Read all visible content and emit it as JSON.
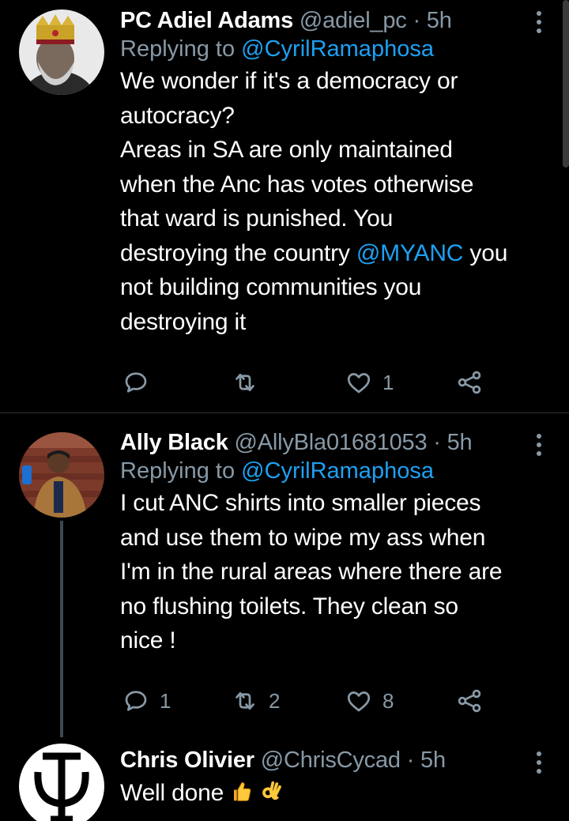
{
  "tweets": [
    {
      "name": "PC Adiel Adams",
      "handle": "@adiel_pc",
      "dot": "·",
      "time": "5h",
      "replying_prefix": "Replying to ",
      "replying_to": "@CyrilRamaphosa",
      "lines": [
        "We wonder if it's a democracy or",
        "autocracy?",
        "Areas in SA are only maintained",
        "when the Anc has votes otherwise",
        "that ward is punished. You"
      ],
      "line6_pre": "destroying the country ",
      "line6_mention": "@MYANC",
      "line6_post": " you",
      "lines_after": [
        "not building communities you",
        "destroying it"
      ],
      "reply_count": "",
      "retweet_count": "",
      "like_count": "1"
    },
    {
      "name": "Ally Black",
      "handle": "@AllyBla01681053",
      "dot": "·",
      "time": "5h",
      "replying_prefix": "Replying to ",
      "replying_to": "@CyrilRamaphosa",
      "lines": [
        "I cut ANC shirts into smaller pieces",
        "and use them to wipe my ass when",
        "I'm in the rural areas where there are",
        "no flushing toilets. They clean so",
        "nice !"
      ],
      "reply_count": "1",
      "retweet_count": "2",
      "like_count": "8"
    },
    {
      "name": "Chris Olivier",
      "handle": "@ChrisCycad",
      "dot": "·",
      "time": "5h",
      "text": "Well done",
      "emojis": [
        "thumbs-up-emoji",
        "ok-hand-emoji"
      ]
    }
  ],
  "colors": {
    "background": "#000000",
    "secondary_text": "#8899a6",
    "mention": "#1da1f2",
    "divider": "#2f3336"
  },
  "icons": [
    "reply-icon",
    "retweet-icon",
    "like-icon",
    "share-icon",
    "more-icon"
  ]
}
